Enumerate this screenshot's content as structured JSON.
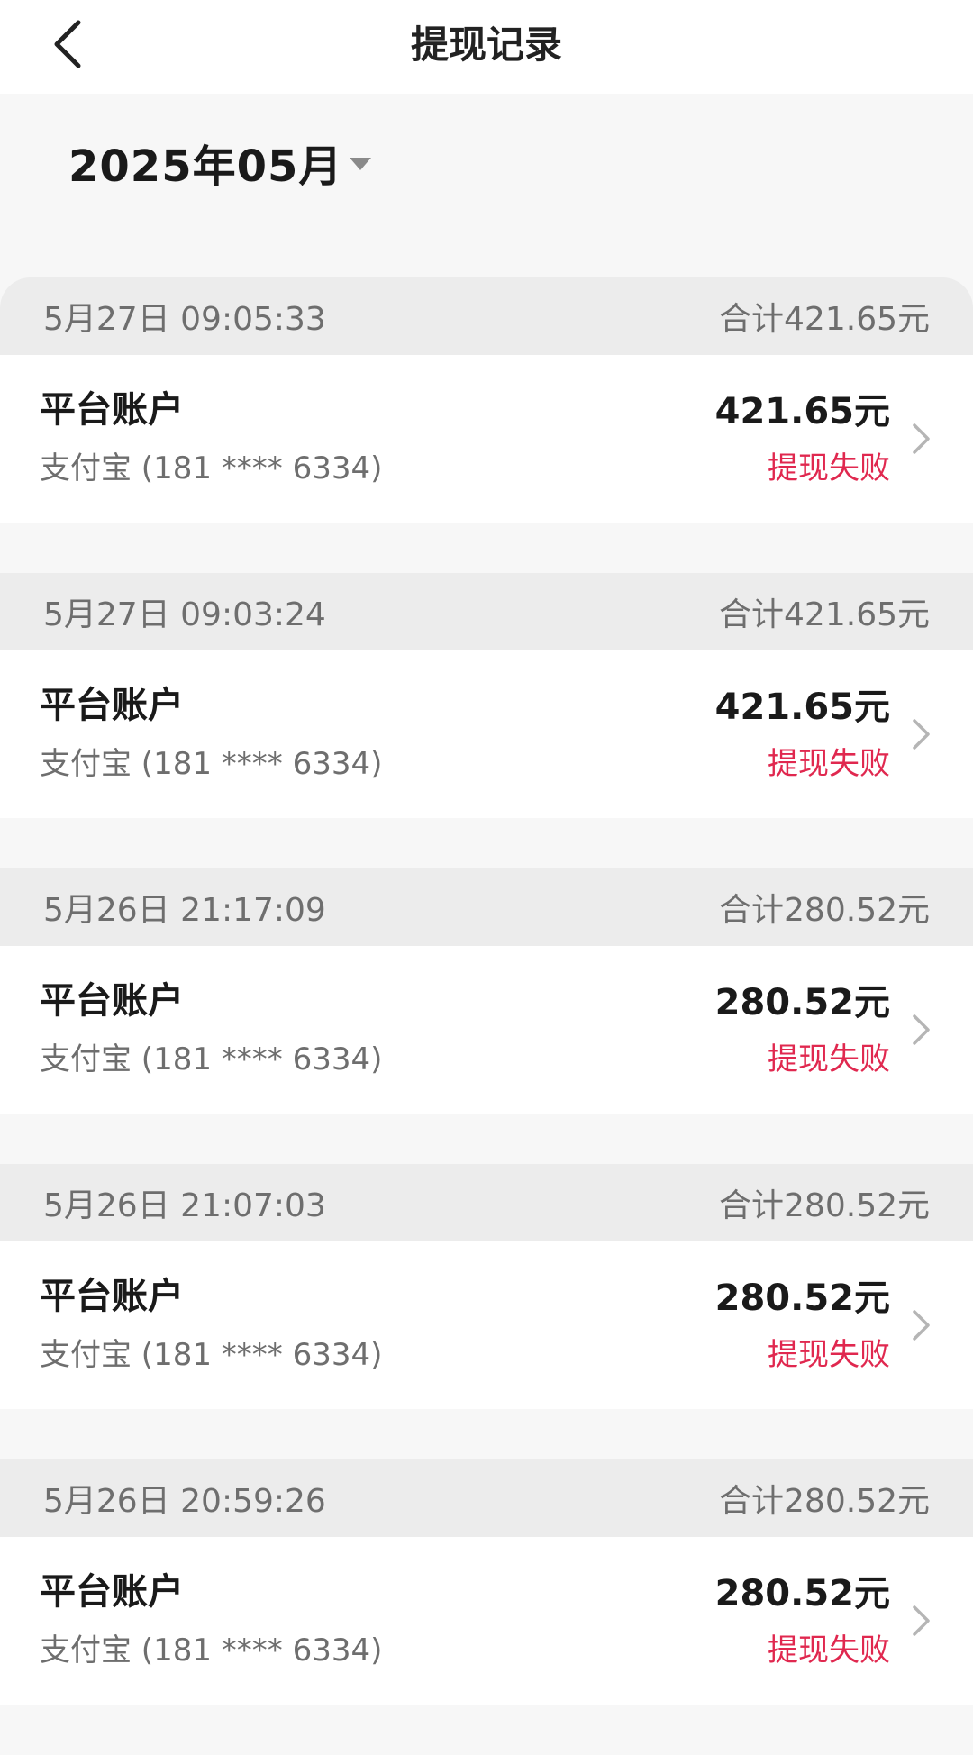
{
  "header": {
    "title": "提现记录",
    "back_icon": "chevron-left-icon"
  },
  "month_picker": {
    "label": "2025年05月",
    "icon": "caret-down-icon"
  },
  "colors": {
    "status_failed": "#e0284f",
    "group_header_bg": "#ececec",
    "page_bg": "#f7f7f7"
  },
  "records": [
    {
      "datetime": "5月27日 09:05:33",
      "total": "合计421.65元",
      "account": "平台账户",
      "method": "支付宝 (181 **** 6334)",
      "amount": "421.65元",
      "status": "提现失败"
    },
    {
      "datetime": "5月27日 09:03:24",
      "total": "合计421.65元",
      "account": "平台账户",
      "method": "支付宝 (181 **** 6334)",
      "amount": "421.65元",
      "status": "提现失败"
    },
    {
      "datetime": "5月26日 21:17:09",
      "total": "合计280.52元",
      "account": "平台账户",
      "method": "支付宝 (181 **** 6334)",
      "amount": "280.52元",
      "status": "提现失败"
    },
    {
      "datetime": "5月26日 21:07:03",
      "total": "合计280.52元",
      "account": "平台账户",
      "method": "支付宝 (181 **** 6334)",
      "amount": "280.52元",
      "status": "提现失败"
    },
    {
      "datetime": "5月26日 20:59:26",
      "total": "合计280.52元",
      "account": "平台账户",
      "method": "支付宝 (181 **** 6334)",
      "amount": "280.52元",
      "status": "提现失败"
    }
  ]
}
